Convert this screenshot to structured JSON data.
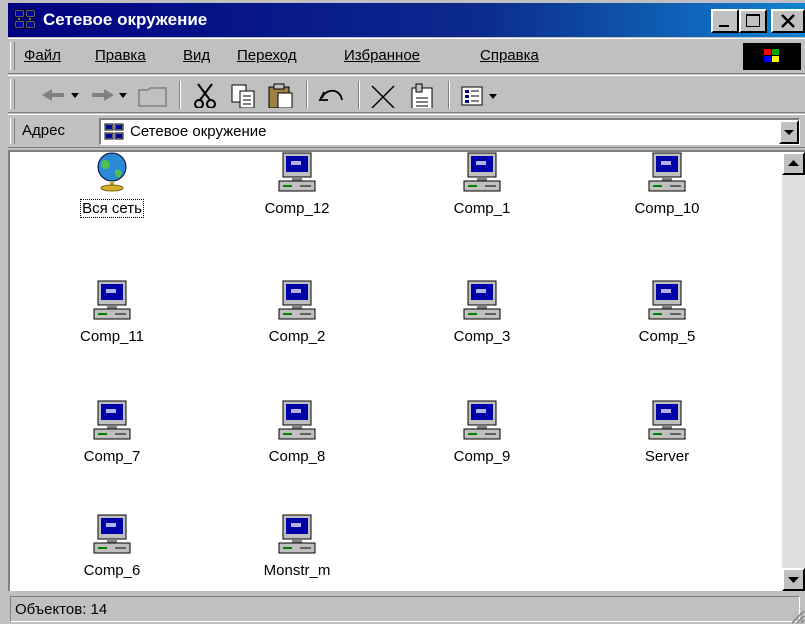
{
  "window": {
    "title": "Сетевое окружение"
  },
  "menu": [
    {
      "label": "Файл"
    },
    {
      "label": "Правка"
    },
    {
      "label": "Вид"
    },
    {
      "label": "Переход"
    },
    {
      "label": "Избранное"
    },
    {
      "label": "Справка"
    }
  ],
  "toolbar": {
    "buttons": [
      "back-icon",
      "forward-icon",
      "up-folder-icon",
      "cut-icon",
      "copy-icon",
      "paste-icon",
      "undo-icon",
      "delete-icon",
      "properties-icon",
      "views-icon"
    ]
  },
  "address": {
    "label": "Адрес",
    "value": "Сетевое окружение"
  },
  "items": [
    {
      "label": "Вся сеть",
      "icon": "globe-icon"
    },
    {
      "label": "Comp_12",
      "icon": "computer-icon"
    },
    {
      "label": "Comp_1",
      "icon": "computer-icon"
    },
    {
      "label": "Comp_10",
      "icon": "computer-icon"
    },
    {
      "label": "Comp_11",
      "icon": "computer-icon"
    },
    {
      "label": "Comp_2",
      "icon": "computer-icon"
    },
    {
      "label": "Comp_3",
      "icon": "computer-icon"
    },
    {
      "label": "Comp_5",
      "icon": "computer-icon"
    },
    {
      "label": "Comp_7",
      "icon": "computer-icon"
    },
    {
      "label": "Comp_8",
      "icon": "computer-icon"
    },
    {
      "label": "Comp_9",
      "icon": "computer-icon"
    },
    {
      "label": "Server",
      "icon": "computer-icon"
    },
    {
      "label": "Comp_6",
      "icon": "computer-icon"
    },
    {
      "label": "Monstr_m",
      "icon": "computer-icon"
    }
  ],
  "status": {
    "text": "Объектов: 14"
  },
  "colors": {
    "titlebar": "#000080",
    "window": "#c0c0c0",
    "content": "#ffffff"
  }
}
